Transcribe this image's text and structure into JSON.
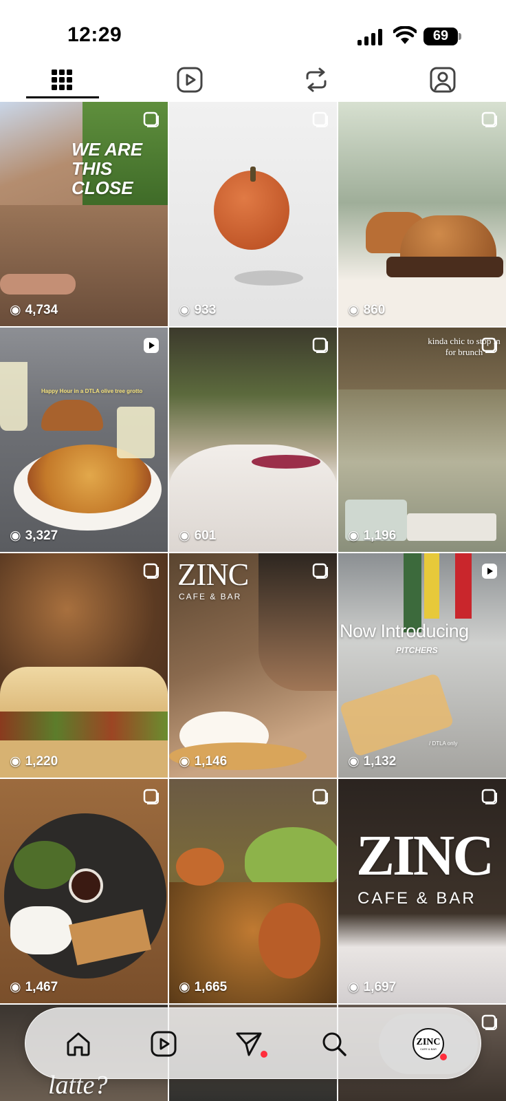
{
  "status_bar": {
    "time": "12:29",
    "battery": "69"
  },
  "tabs": [
    {
      "name": "grid",
      "icon": "grid-icon",
      "active": true
    },
    {
      "name": "reels",
      "icon": "reels-icon",
      "active": false
    },
    {
      "name": "reposts",
      "icon": "repost-icon",
      "active": false
    },
    {
      "name": "tagged",
      "icon": "tagged-icon",
      "active": false
    }
  ],
  "posts": [
    {
      "views": "4,734",
      "overlay": "WE ARE THIS CLOSE",
      "type": "carousel"
    },
    {
      "views": "933",
      "overlay": "",
      "type": "carousel"
    },
    {
      "views": "860",
      "overlay": "",
      "type": "carousel"
    },
    {
      "views": "3,327",
      "overlay": "Happy Hour in a DTLA olive tree grotto",
      "type": "reel"
    },
    {
      "views": "601",
      "overlay": "",
      "type": "carousel"
    },
    {
      "views": "1,196",
      "overlay": "kinda chic to stop in for brunch",
      "type": "carousel"
    },
    {
      "views": "1,220",
      "overlay": "",
      "type": "carousel"
    },
    {
      "views": "1,146",
      "overlay": "ZINC",
      "overlay2": "CAFE & BAR",
      "type": "carousel"
    },
    {
      "views": "1,132",
      "overlay": "Now Introducing",
      "overlay2": "PITCHERS",
      "overlay3": "/ DTLA only",
      "type": "reel"
    },
    {
      "views": "1,467",
      "overlay": "",
      "type": "carousel"
    },
    {
      "views": "1,665",
      "overlay": "",
      "type": "carousel"
    },
    {
      "views": "1,697",
      "overlay": "ZINC",
      "overlay2": "CAFE & BAR",
      "type": "carousel"
    }
  ],
  "partial_row_text": "latte?",
  "bottom_nav": {
    "items": [
      "home-icon",
      "reels-icon",
      "send-icon",
      "search-icon",
      "profile-avatar"
    ],
    "avatar_text": "ZINC",
    "avatar_sub": "CAFE & BAR"
  }
}
